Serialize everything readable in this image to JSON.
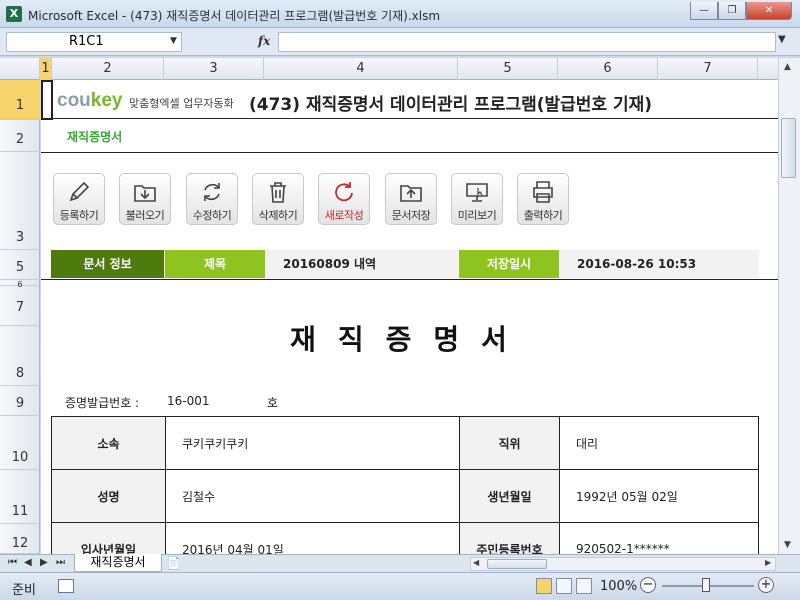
{
  "window": {
    "title": "Microsoft Excel - (473) 재직증명서 데이터관리 프로그램(발급번호 기재).xlsm",
    "app_icon": "X",
    "minimize": "—",
    "maximize": "❐",
    "close": "✕"
  },
  "formula_bar": {
    "name_box": "R1C1",
    "fx": "fx",
    "value": ""
  },
  "columns": [
    "1",
    "2",
    "3",
    "4",
    "5",
    "6",
    "7"
  ],
  "rows": [
    "1",
    "2",
    "3",
    "5",
    "6",
    "7",
    "8",
    "9",
    "10",
    "11",
    "12"
  ],
  "header": {
    "logo_brand_a": "cou",
    "logo_brand_b": "key",
    "logo_sub": "맞춤형엑셀 업무자동화",
    "title": "(473) 재직증명서 데이터관리 프로그램(발급번호 기재)",
    "sheet_name": "재직증명서"
  },
  "toolbar": [
    {
      "label": "등록하기",
      "icon": "pencil-icon"
    },
    {
      "label": "불러오기",
      "icon": "folder-download-icon"
    },
    {
      "label": "수정하기",
      "icon": "refresh-icon"
    },
    {
      "label": "삭제하기",
      "icon": "trash-icon"
    },
    {
      "label": "새로작성",
      "icon": "reload-icon"
    },
    {
      "label": "문서저장",
      "icon": "folder-upload-icon"
    },
    {
      "label": "미리보기",
      "icon": "monitor-icon"
    },
    {
      "label": "출력하기",
      "icon": "printer-icon"
    }
  ],
  "info": {
    "doc_info_label": "문서 정보",
    "subject_label": "제목",
    "subject_value": "20160809 내역",
    "saved_label": "저장일시",
    "saved_value": "2016-08-26 10:53"
  },
  "certificate": {
    "title": "재직증명서",
    "issue_label": "증명발급번호 :",
    "issue_no": "16-001",
    "issue_suffix": "호",
    "rows": [
      {
        "l1": "소속",
        "v1": "쿠키쿠키쿠키",
        "l2": "직위",
        "v2": "대리"
      },
      {
        "l1": "성명",
        "v1": "김철수",
        "l2": "생년월일",
        "v2": "1992년 05월 02일"
      },
      {
        "l1": "입사년월일",
        "v1": "2016년 04월 01일",
        "l2": "주민등록번호",
        "v2": "920502-1******"
      }
    ]
  },
  "sheet_tabs": {
    "active": "재직증명서"
  },
  "status": {
    "ready": "준비",
    "zoom": "100%"
  },
  "colors": {
    "dark_green": "#4e7a0e",
    "light_green": "#8fc31f",
    "logo_green": "#76b82a",
    "sheet_title_green": "#3aa53a"
  }
}
